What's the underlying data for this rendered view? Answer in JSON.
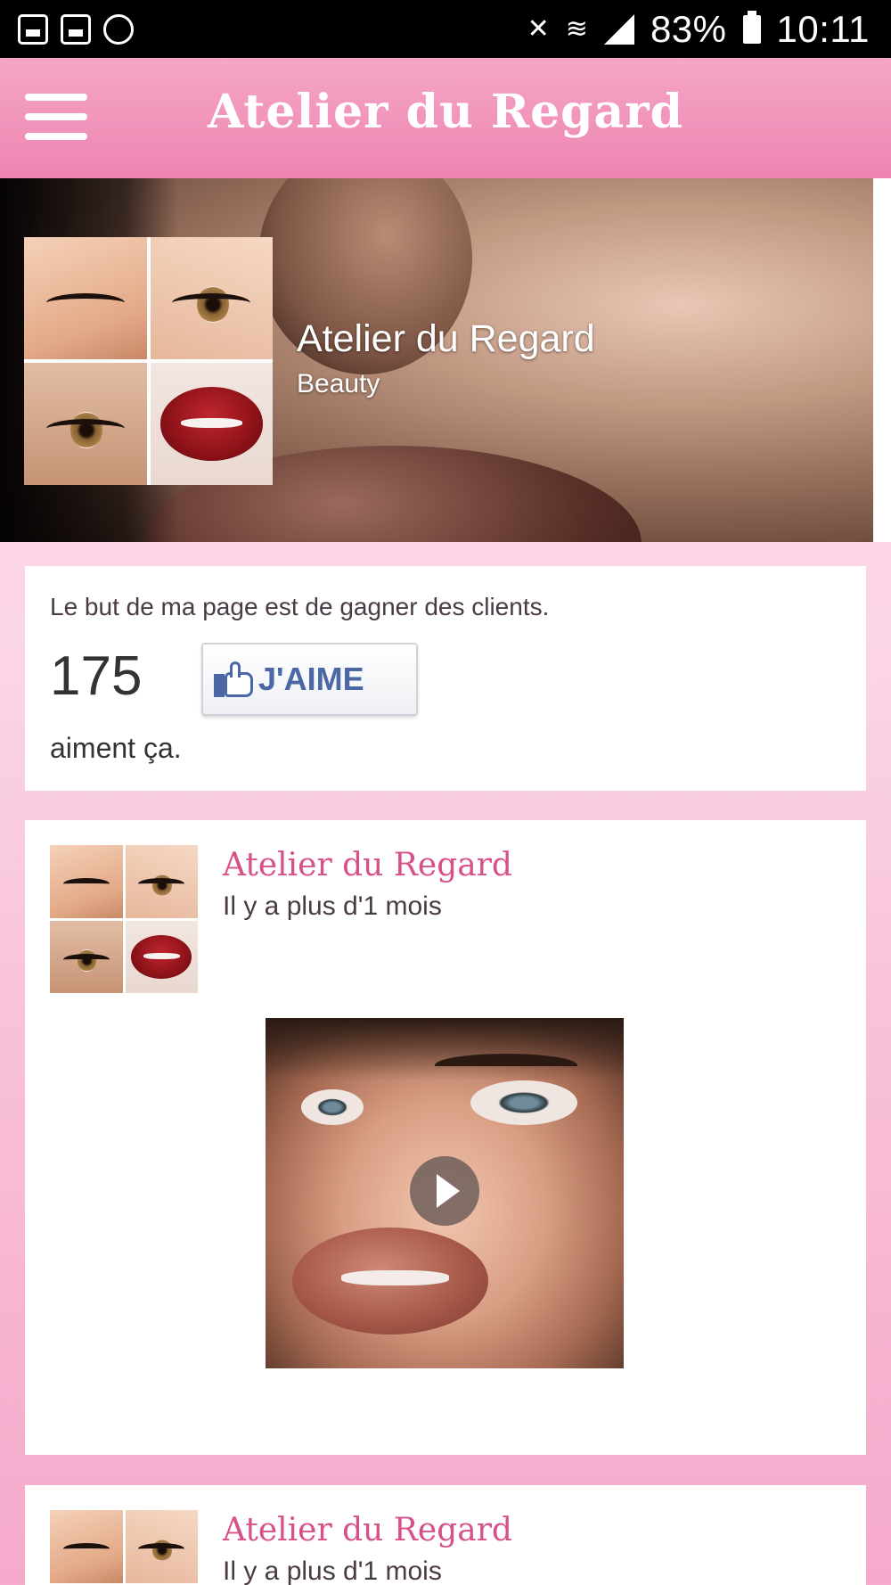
{
  "status_bar": {
    "battery": "83%",
    "time": "10:11",
    "icons": [
      "gallery-icon",
      "gmail-icon",
      "sync-icon",
      "mute-icon",
      "wifi-icon",
      "signal-icon",
      "battery-icon"
    ]
  },
  "app_bar": {
    "title": "Atelier du Regard",
    "menu_icon": "hamburger-menu-icon"
  },
  "cover": {
    "page_name": "Atelier du Regard",
    "category": "Beauty"
  },
  "about": {
    "text": "Le but de ma page est de gagner des clients.",
    "like_count": "175",
    "like_button": "J'AIME",
    "like_suffix": "aiment ça."
  },
  "posts": [
    {
      "author": "Atelier du Regard",
      "time": "Il y a plus d'1 mois",
      "media": "video"
    },
    {
      "author": "Atelier du Regard",
      "time": "Il y a plus d'1 mois"
    }
  ],
  "colors": {
    "accent": "#ee84b0",
    "author_pink": "#d8508a",
    "facebook_blue": "#4b67a6"
  }
}
